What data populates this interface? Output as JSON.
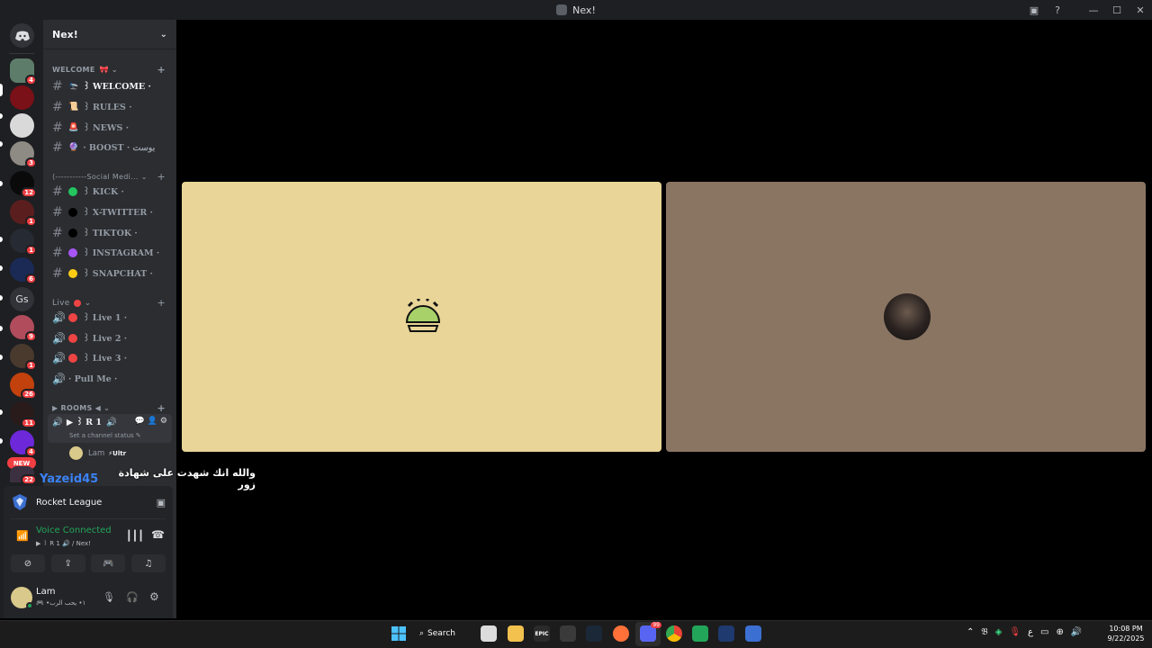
{
  "window": {
    "title": "Nex!"
  },
  "server_badges": [
    "4",
    "3",
    "12",
    "1",
    "1",
    "6",
    "9",
    "1",
    "26",
    "11",
    "4",
    "22"
  ],
  "server_text": {
    "gs": "Gs",
    "new": "NEW"
  },
  "guild": {
    "name": "Nex!"
  },
  "categories": {
    "welcome": "WELCOME",
    "social": "⟨-----------Social Medi...",
    "live": "Live",
    "rooms": "▶ ROOMS ◀"
  },
  "text_channels": [
    {
      "label": "꒱ WELCOME ·",
      "icon": "🛬"
    },
    {
      "label": "꒱ RULES ·",
      "icon": "📜"
    },
    {
      "label": "꒱ NEWS ·",
      "icon": "🚨"
    },
    {
      "label": "· BOOST · بوست",
      "icon": "🔮"
    }
  ],
  "social_channels": [
    {
      "label": "꒱ KICK ·",
      "color": "#23c55e"
    },
    {
      "label": "꒱ X-TWITTER ·",
      "color": "#000000"
    },
    {
      "label": "꒱ TIKTOK ·",
      "color": "#000000"
    },
    {
      "label": "꒱ INSTAGRAM ·",
      "color": "#a855f7"
    },
    {
      "label": "꒱ SNAPCHAT ·",
      "color": "#facc15"
    }
  ],
  "live_channels": [
    {
      "label": "꒱ Live 1 ·",
      "color": "#ef4444"
    },
    {
      "label": "꒱ Live 2 ·",
      "color": "#ef4444"
    },
    {
      "label": "꒱ Live 3 ·",
      "color": "#ef4444"
    },
    {
      "label": "· Pull Me ·",
      "color": ""
    }
  ],
  "voice_room": {
    "label": "▶ ꒱ R 1",
    "status": "Set a channel status",
    "member_name": "Lam",
    "member_tag": "⚡Ultr"
  },
  "overlay": {
    "user": "Yazeid45",
    "message": "والله انك شهدت على شهادة زور"
  },
  "activity": {
    "game": "Rocket League"
  },
  "voice": {
    "status": "Voice Connected",
    "channel": "▶ ꒱ R 1 🔊 / Nex!"
  },
  "user": {
    "name": "Lam",
    "status": "🎮 •١• يحب الرب"
  },
  "taskbar": {
    "search": "Search",
    "time": "10:08 PM",
    "date": "9/22/2025",
    "lang": "ع",
    "epic": "EPIC",
    "discord_badge": "99"
  },
  "colors": {
    "tile_left": "#e8d597",
    "tile_right": "#8a7563",
    "brand": "#5865f2",
    "voice_green": "#23a559"
  }
}
